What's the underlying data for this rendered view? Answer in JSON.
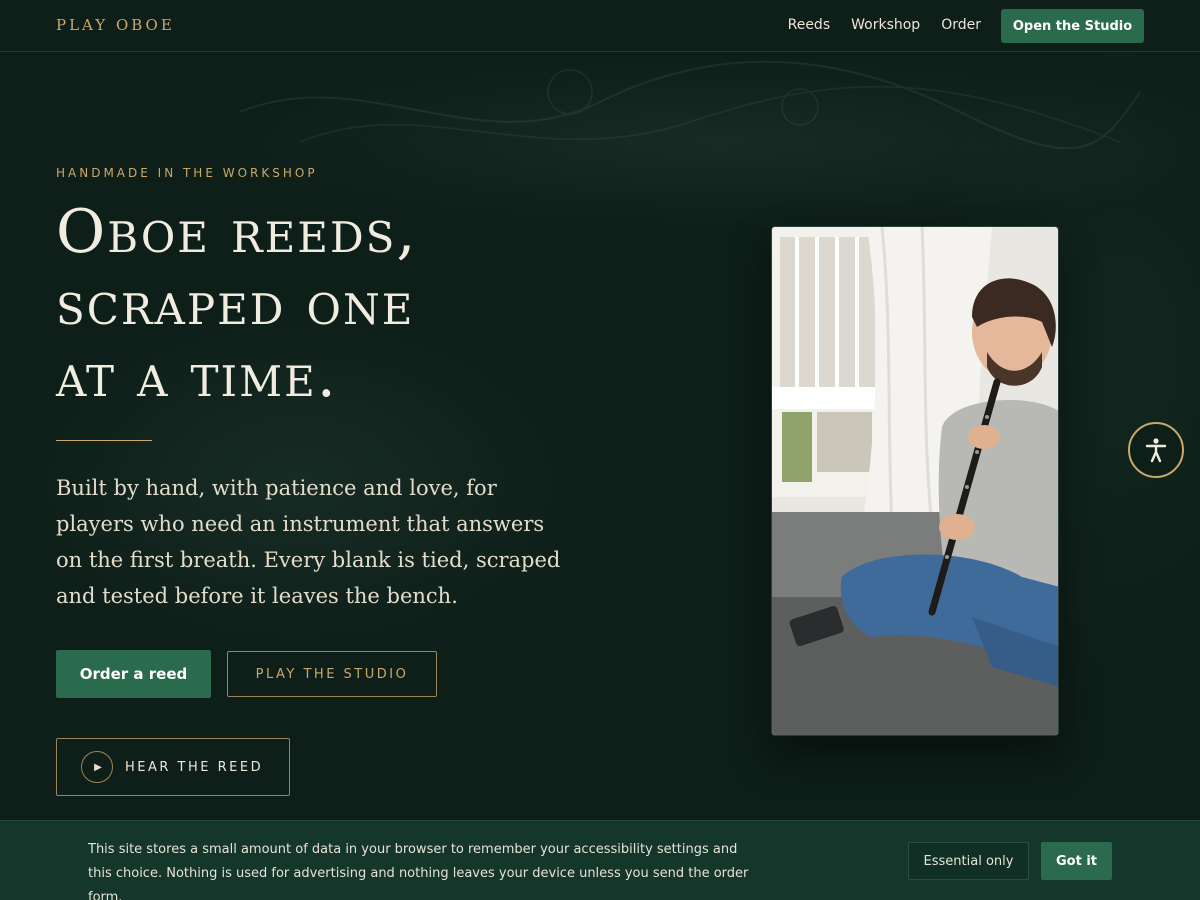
{
  "nav": {
    "brand": "PLAY OBOE",
    "links": [
      "Reeds",
      "Workshop",
      "Order"
    ],
    "cta": "Open the Studio"
  },
  "hero": {
    "eyebrow": "HANDMADE IN THE WORKSHOP",
    "headline_lines": [
      "Oboe reeds,",
      "scraped one",
      "at a time."
    ],
    "lede": "Built by hand, with patience and love, for players who need an instrument that answers on the first breath. Every blank is tied, scraped and tested before it leaves the bench.",
    "primary_button": "Order a reed",
    "secondary_button": "PLAY THE STUDIO",
    "audio_button": "HEAR THE REED"
  },
  "photo": {
    "subject": "player-with-oboe"
  },
  "accessibility": {
    "icon": "accessibility-icon"
  },
  "cookie": {
    "text": "This site stores a small amount of data in your browser to remember your accessibility settings and this choice. Nothing is used for advertising and nothing leaves your device unless you send the order form.",
    "essential_button": "Essential only",
    "accept_button": "Got it"
  },
  "colors": {
    "background": "#0e1e19",
    "accent_gold": "#c9a96a",
    "primary_green": "#2a6b4d",
    "banner": "#14362b"
  }
}
